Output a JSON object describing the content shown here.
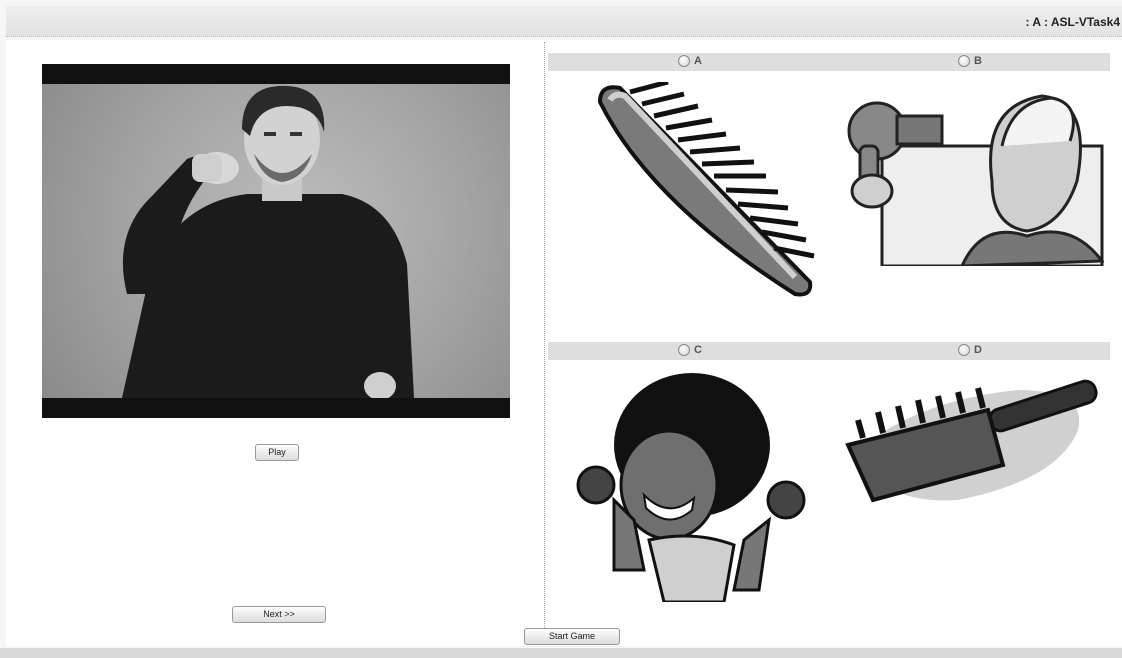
{
  "header": {
    "title": ": A : ASL-VTask4"
  },
  "video": {
    "play_label": "Play"
  },
  "nav": {
    "next_label": "Next >>",
    "start_label": "Start Game"
  },
  "options": [
    {
      "letter": "A",
      "icon": "comb-icon"
    },
    {
      "letter": "B",
      "icon": "hair-dryer-icon"
    },
    {
      "letter": "C",
      "icon": "messy-hair-icon"
    },
    {
      "letter": "D",
      "icon": "hairbrush-icon"
    }
  ]
}
